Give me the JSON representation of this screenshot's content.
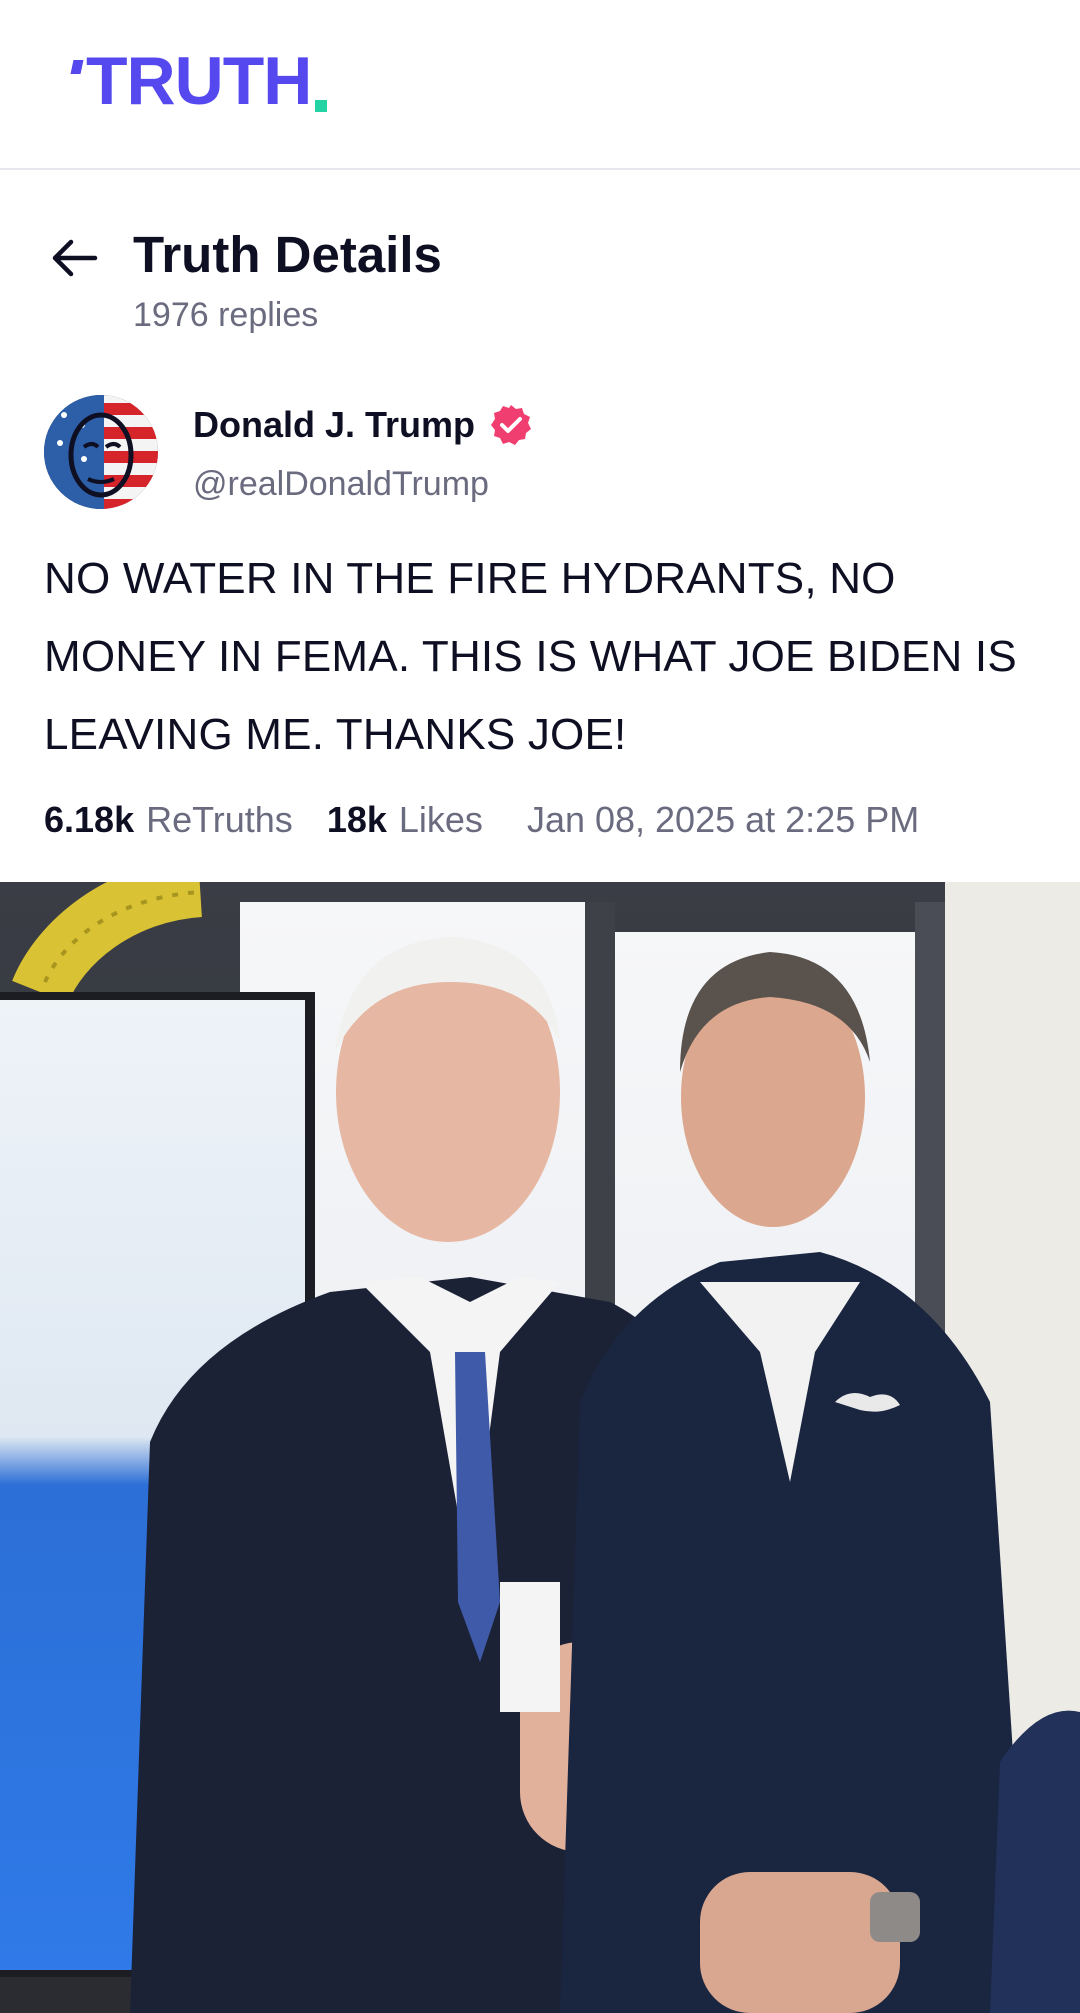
{
  "app": {
    "logo_text": "TRUTH",
    "brand_color": "#5448ee",
    "accent_color": "#23d3a4"
  },
  "header": {
    "title": "Truth Details",
    "replies": "1976 replies",
    "back_icon": "arrow-left-icon"
  },
  "author": {
    "name": "Donald J. Trump",
    "handle": "@realDonaldTrump",
    "verified": true,
    "verified_color": "#ef3e6f",
    "avatar": "user-avatar"
  },
  "post": {
    "text": "NO WATER IN THE FIRE HYDRANTS, NO MONEY IN FEMA. THIS IS WHAT JOE BIDEN IS LEAVING ME. THANKS JOE!",
    "retruths_count": "6.18k",
    "retruths_label": "ReTruths",
    "likes_count": "18k",
    "likes_label": "Likes",
    "timestamp": "Jan 08, 2025 at 2:25 PM"
  },
  "media": {
    "type": "photo",
    "icon": "image-attachment"
  }
}
